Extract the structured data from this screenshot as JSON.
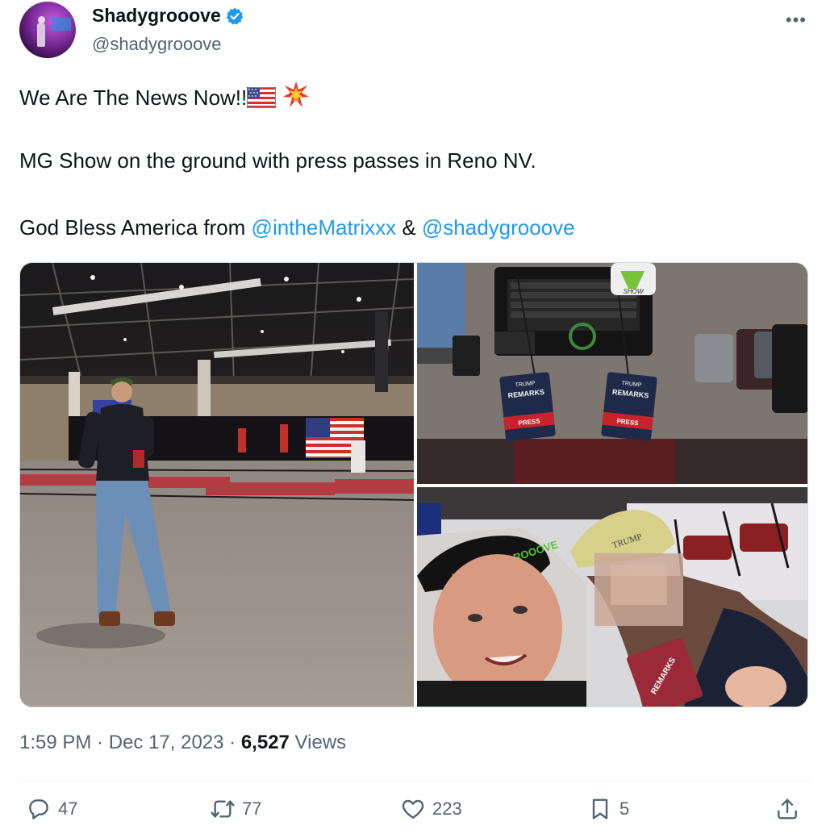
{
  "author": {
    "display_name": "Shadygrooove",
    "handle": "@shadygrooove",
    "verified": true
  },
  "tweet": {
    "line1_text": "We Are The News Now!!",
    "line1_emojis": [
      "us-flag-icon",
      "collision-icon"
    ],
    "line2_text": "MG Show on the ground with press passes in Reno NV.",
    "line3_prefix": "God Bless America from ",
    "mention1": "@intheMatrixxx",
    "line3_join": " & ",
    "mention2": "@shadygrooove"
  },
  "media": {
    "photo2_badge_brand": "TRUMP",
    "photo2_badge_title": "REMARKS",
    "photo2_badge_tag": "PRESS",
    "photo2_logo_text": "SHOW",
    "photo3_cap_text": "MATRIXXX GROOOVE",
    "photo3_hat_text": "TRUMP",
    "photo3_pass_title": "REMARKS"
  },
  "meta": {
    "time": "1:59 PM",
    "sep1": " · ",
    "date": "Dec 17, 2023",
    "sep2": " · ",
    "views_count": "6,527",
    "views_label": " Views"
  },
  "actions": {
    "replies": "47",
    "reposts": "77",
    "likes": "223",
    "bookmarks": "5"
  },
  "colors": {
    "link": "#1d9bf0",
    "secondary_text": "#536471",
    "verified": "#1d9bf0"
  }
}
